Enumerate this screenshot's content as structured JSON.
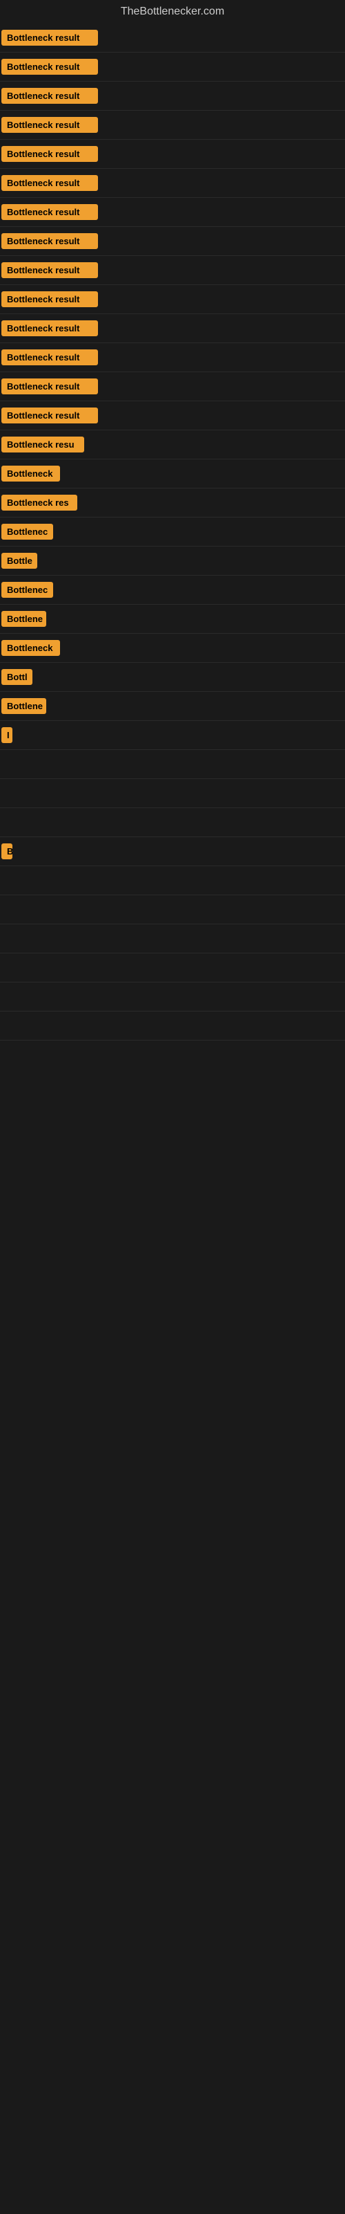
{
  "header": {
    "title": "TheBottlenecker.com"
  },
  "results": [
    {
      "id": 1,
      "label": "Bottleneck result",
      "width": 140
    },
    {
      "id": 2,
      "label": "Bottleneck result",
      "width": 140
    },
    {
      "id": 3,
      "label": "Bottleneck result",
      "width": 140
    },
    {
      "id": 4,
      "label": "Bottleneck result",
      "width": 140
    },
    {
      "id": 5,
      "label": "Bottleneck result",
      "width": 140
    },
    {
      "id": 6,
      "label": "Bottleneck result",
      "width": 140
    },
    {
      "id": 7,
      "label": "Bottleneck result",
      "width": 140
    },
    {
      "id": 8,
      "label": "Bottleneck result",
      "width": 140
    },
    {
      "id": 9,
      "label": "Bottleneck result",
      "width": 140
    },
    {
      "id": 10,
      "label": "Bottleneck result",
      "width": 140
    },
    {
      "id": 11,
      "label": "Bottleneck result",
      "width": 140
    },
    {
      "id": 12,
      "label": "Bottleneck result",
      "width": 140
    },
    {
      "id": 13,
      "label": "Bottleneck result",
      "width": 140
    },
    {
      "id": 14,
      "label": "Bottleneck result",
      "width": 140
    },
    {
      "id": 15,
      "label": "Bottleneck resu",
      "width": 120
    },
    {
      "id": 16,
      "label": "Bottleneck",
      "width": 85
    },
    {
      "id": 17,
      "label": "Bottleneck res",
      "width": 110
    },
    {
      "id": 18,
      "label": "Bottlenec",
      "width": 75
    },
    {
      "id": 19,
      "label": "Bottle",
      "width": 52
    },
    {
      "id": 20,
      "label": "Bottlenec",
      "width": 75
    },
    {
      "id": 21,
      "label": "Bottlene",
      "width": 65
    },
    {
      "id": 22,
      "label": "Bottleneck",
      "width": 85
    },
    {
      "id": 23,
      "label": "Bottl",
      "width": 45
    },
    {
      "id": 24,
      "label": "Bottlene",
      "width": 65
    },
    {
      "id": 25,
      "label": "I",
      "width": 10
    },
    {
      "id": 26,
      "label": "",
      "width": 0
    },
    {
      "id": 27,
      "label": "",
      "width": 0
    },
    {
      "id": 28,
      "label": "",
      "width": 0
    },
    {
      "id": 29,
      "label": "B",
      "width": 12
    },
    {
      "id": 30,
      "label": "",
      "width": 0
    },
    {
      "id": 31,
      "label": "",
      "width": 0
    },
    {
      "id": 32,
      "label": "",
      "width": 0
    },
    {
      "id": 33,
      "label": "",
      "width": 0
    },
    {
      "id": 34,
      "label": "",
      "width": 0
    },
    {
      "id": 35,
      "label": "",
      "width": 0
    }
  ]
}
